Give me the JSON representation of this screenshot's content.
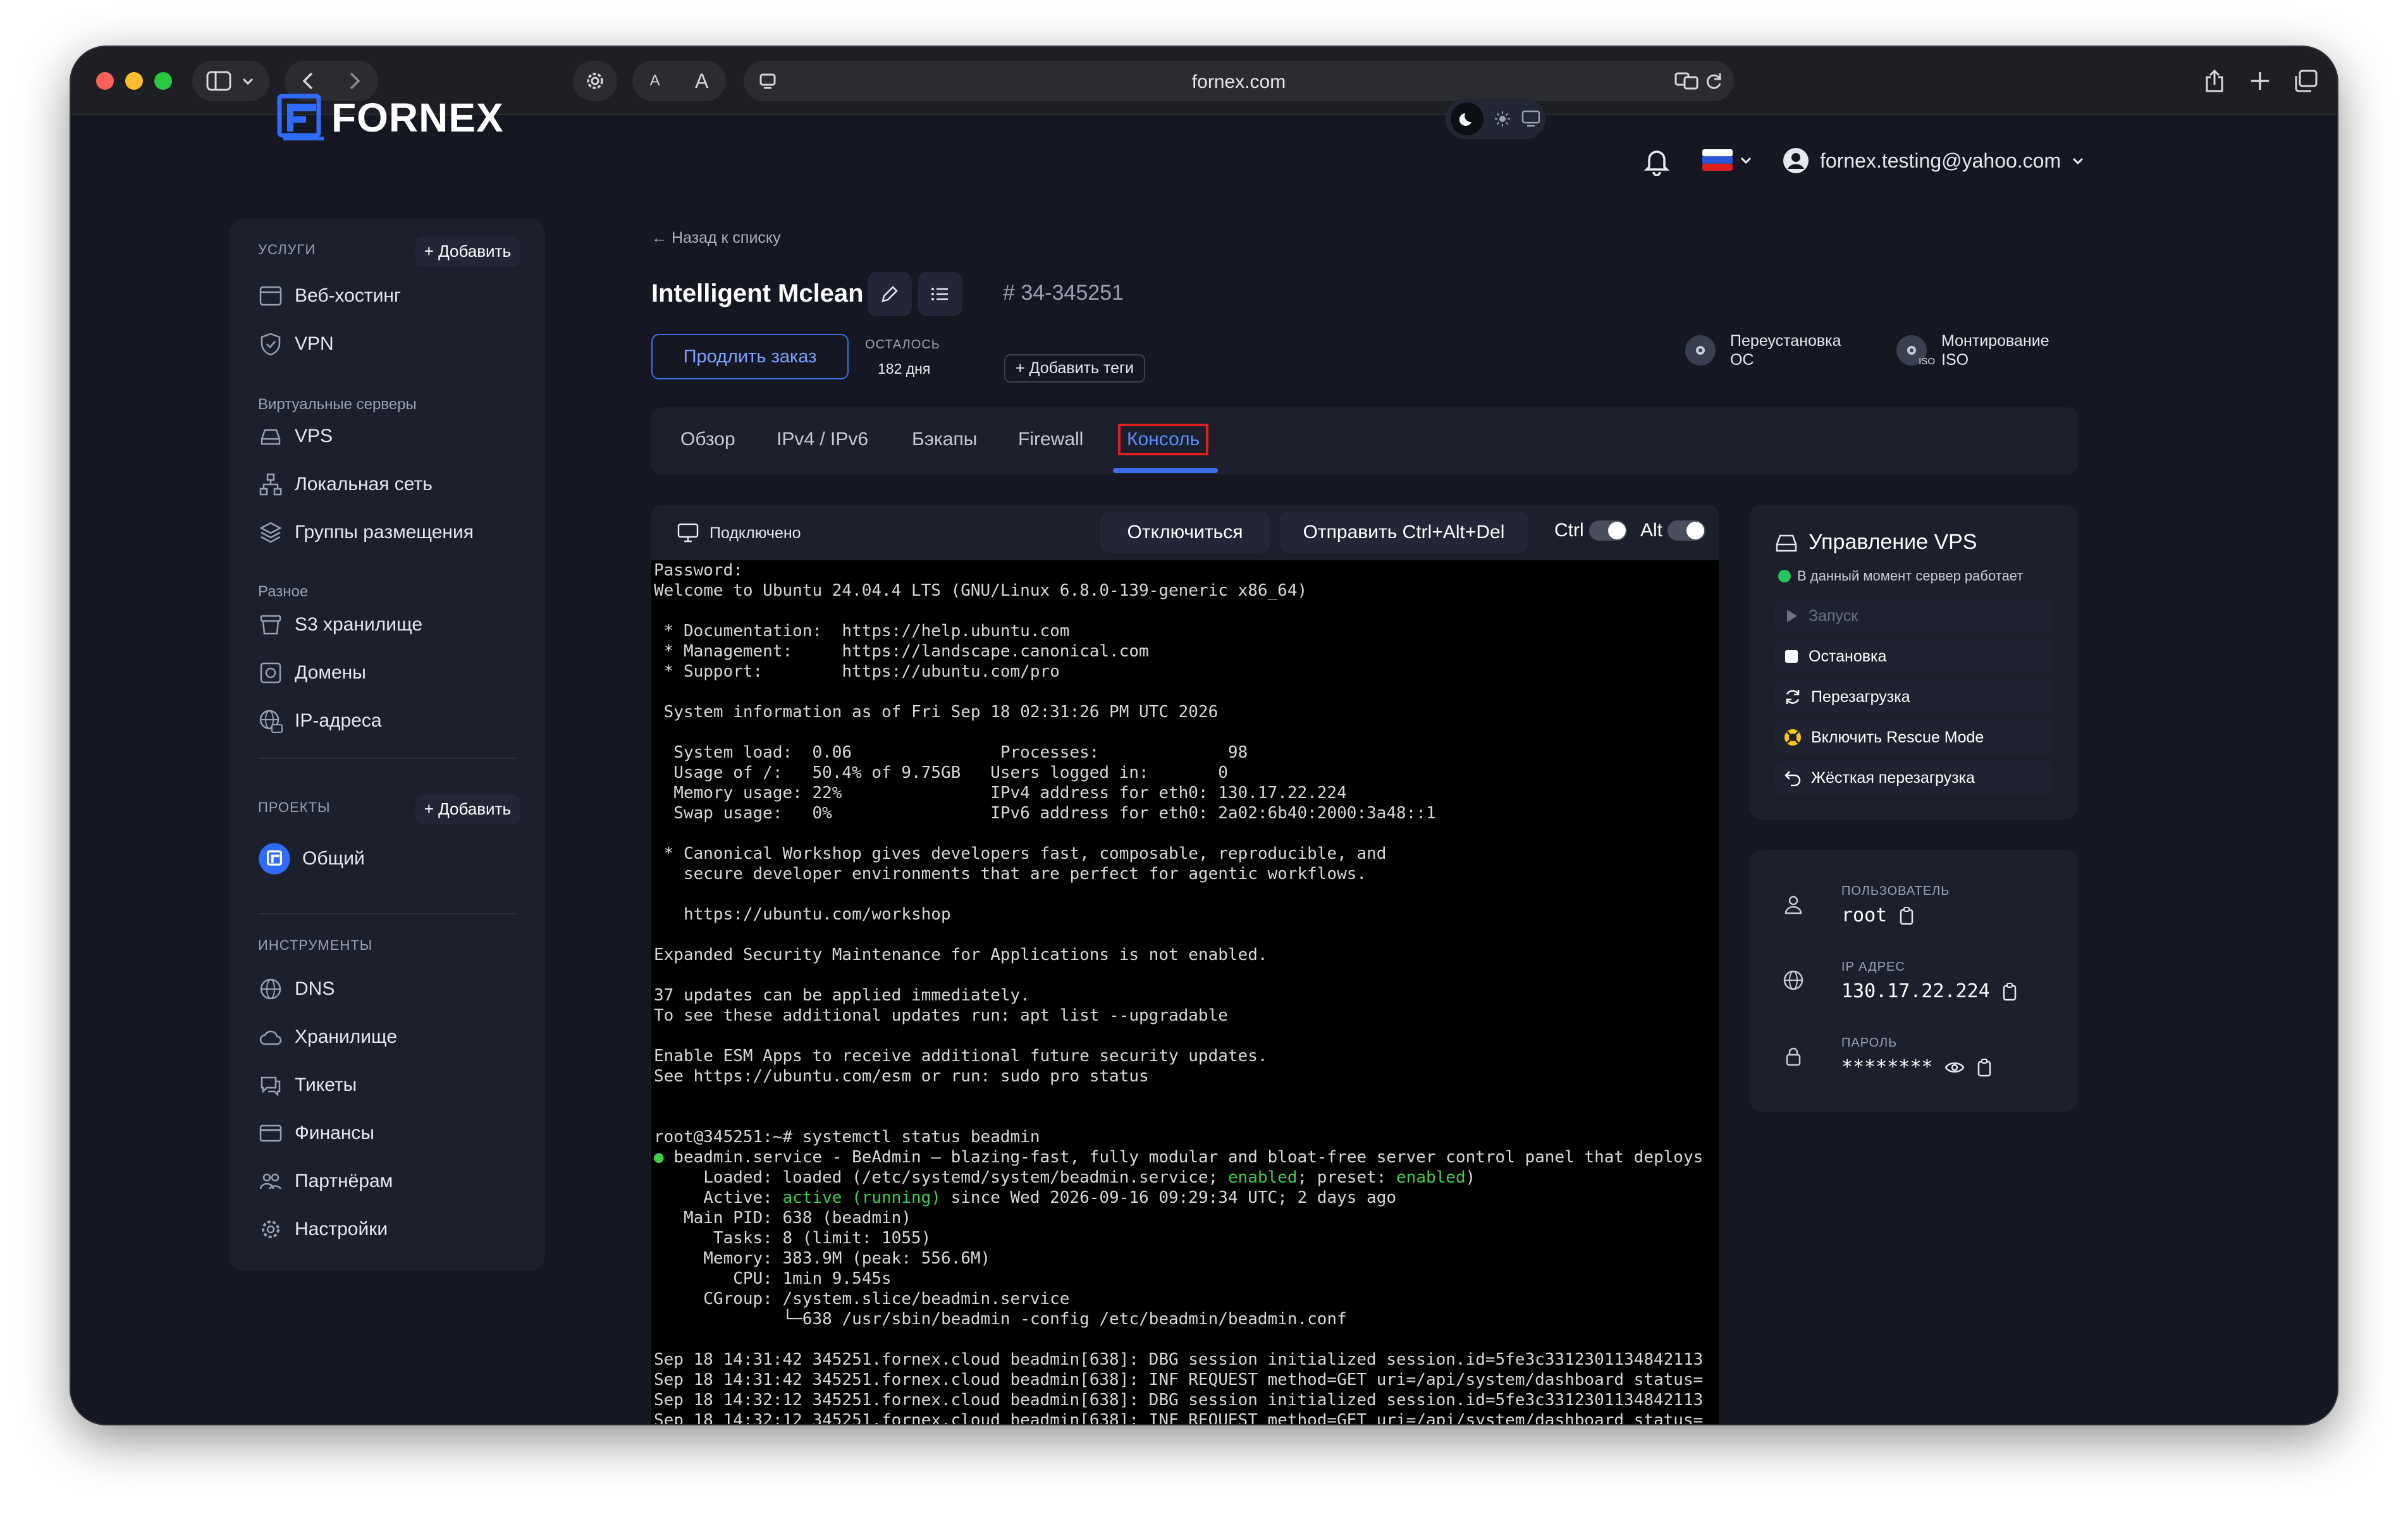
{
  "browser": {
    "url": "fornex.com",
    "font_small": "A",
    "font_large": "A"
  },
  "header": {
    "logo_text": "FORNEX",
    "user_email": "fornex.testing@yahoo.com"
  },
  "sidebar": {
    "services_title": "УСЛУГИ",
    "add_label": "+ Добавить",
    "services": [
      "Веб-хостинг",
      "VPN"
    ],
    "virtual_title": "Виртуальные серверы",
    "virtual": [
      "VPS",
      "Локальная сеть",
      "Группы размещения"
    ],
    "misc_title": "Разное",
    "misc": [
      "S3 хранилище",
      "Домены",
      "IP-адреса"
    ],
    "projects_title": "ПРОЕКТЫ",
    "projects": [
      "Общий"
    ],
    "tools_title": "ИНСТРУМЕНТЫ",
    "tools": [
      "DNS",
      "Хранилище",
      "Тикеты",
      "Финансы",
      "Партнёрам",
      "Настройки"
    ]
  },
  "main": {
    "back_label": "← Назад к списку",
    "server_name": "Intelligent Mclean",
    "order_id": "# 34-345251",
    "renew_label": "Продлить заказ",
    "remaining_label": "ОСТАЛОСЬ",
    "remaining_value": "182 дня",
    "tags_label": "+ Добавить теги",
    "reinstall_label_1": "Переустановка",
    "reinstall_label_2": "ОС",
    "mount_label_1": "Монтирование",
    "mount_label_2": "ISO",
    "mount_badge": "ISO",
    "tabs": [
      "Обзор",
      "IPv4 / IPv6",
      "Бэкапы",
      "Firewall",
      "Консоль"
    ]
  },
  "console": {
    "status": "Подключено",
    "disconnect_label": "Отключиться",
    "send_cad_label": "Отправить Ctrl+Alt+Del",
    "ctrl_label": "Ctrl",
    "alt_label": "Alt",
    "lines": [
      "Password:",
      "Welcome to Ubuntu 24.04.4 LTS (GNU/Linux 6.8.0-139-generic x86_64)",
      "",
      " * Documentation:  https://help.ubuntu.com",
      " * Management:     https://landscape.canonical.com",
      " * Support:        https://ubuntu.com/pro",
      "",
      " System information as of Fri Sep 18 02:31:26 PM UTC 2026",
      "",
      "  System load:  0.06               Processes:             98",
      "  Usage of /:   50.4% of 9.75GB   Users logged in:       0",
      "  Memory usage: 22%               IPv4 address for eth0: 130.17.22.224",
      "  Swap usage:   0%                IPv6 address for eth0: 2a02:6b40:2000:3a48::1",
      "",
      " * Canonical Workshop gives developers fast, composable, reproducible, and",
      "   secure developer environments that are perfect for agentic workflows.",
      "",
      "   https://ubuntu.com/workshop",
      "",
      "Expanded Security Maintenance for Applications is not enabled.",
      "",
      "37 updates can be applied immediately.",
      "To see these additional updates run: apt list --upgradable",
      "",
      "Enable ESM Apps to receive additional future security updates.",
      "See https://ubuntu.com/esm or run: sudo pro status",
      "",
      "",
      "root@345251:~# systemctl status beadmin"
    ],
    "svc_bullet": "●",
    "svc_line": " beadmin.service - BeAdmin – blazing-fast, fully modular and bloat-free server control panel that deploys",
    "loaded_prefix": "     Loaded: loaded (/etc/systemd/system/beadmin.service; ",
    "loaded_enabled": "enabled",
    "loaded_mid": "; preset: ",
    "loaded_preset": "enabled",
    "loaded_suffix": ")",
    "active_prefix": "     Active: ",
    "active_state": "active (running)",
    "active_suffix": " since Wed 2026-09-16 09:29:34 UTC; 2 days ago",
    "tail_lines": [
      "   Main PID: 638 (beadmin)",
      "      Tasks: 8 (limit: 1055)",
      "     Memory: 383.9M (peak: 556.6M)",
      "        CPU: 1min 9.545s",
      "     CGroup: /system.slice/beadmin.service",
      "             └─638 /usr/sbin/beadmin -config /etc/beadmin/beadmin.conf",
      "",
      "Sep 18 14:31:42 345251.fornex.cloud beadmin[638]: DBG session initialized session.id=5fe3c3312301134842113",
      "Sep 18 14:31:42 345251.fornex.cloud beadmin[638]: INF REQUEST method=GET uri=/api/system/dashboard status=",
      "Sep 18 14:32:12 345251.fornex.cloud beadmin[638]: DBG session initialized session.id=5fe3c3312301134842113",
      "Sep 18 14:32:12 345251.fornex.cloud beadmin[638]: INF REQUEST method=GET uri=/api/system/dashboard status="
    ]
  },
  "vps_panel": {
    "title": "Управление VPS",
    "status": "В данный момент сервер работает",
    "actions": [
      "Запуск",
      "Остановка",
      "Перезагрузка",
      "Включить Rescue Mode",
      "Жёсткая перезагрузка"
    ]
  },
  "credentials": {
    "user_label": "ПОЛЬЗОВАТЕЛЬ",
    "user_value": "root",
    "ip_label": "IP АДРЕС",
    "ip_value": "130.17.22.224",
    "password_label": "ПАРОЛЬ",
    "password_value": "********"
  },
  "colors": {
    "accent": "#3a6fe8",
    "running": "#22c55e",
    "background": "#151823",
    "panel": "#1c1f2c"
  }
}
